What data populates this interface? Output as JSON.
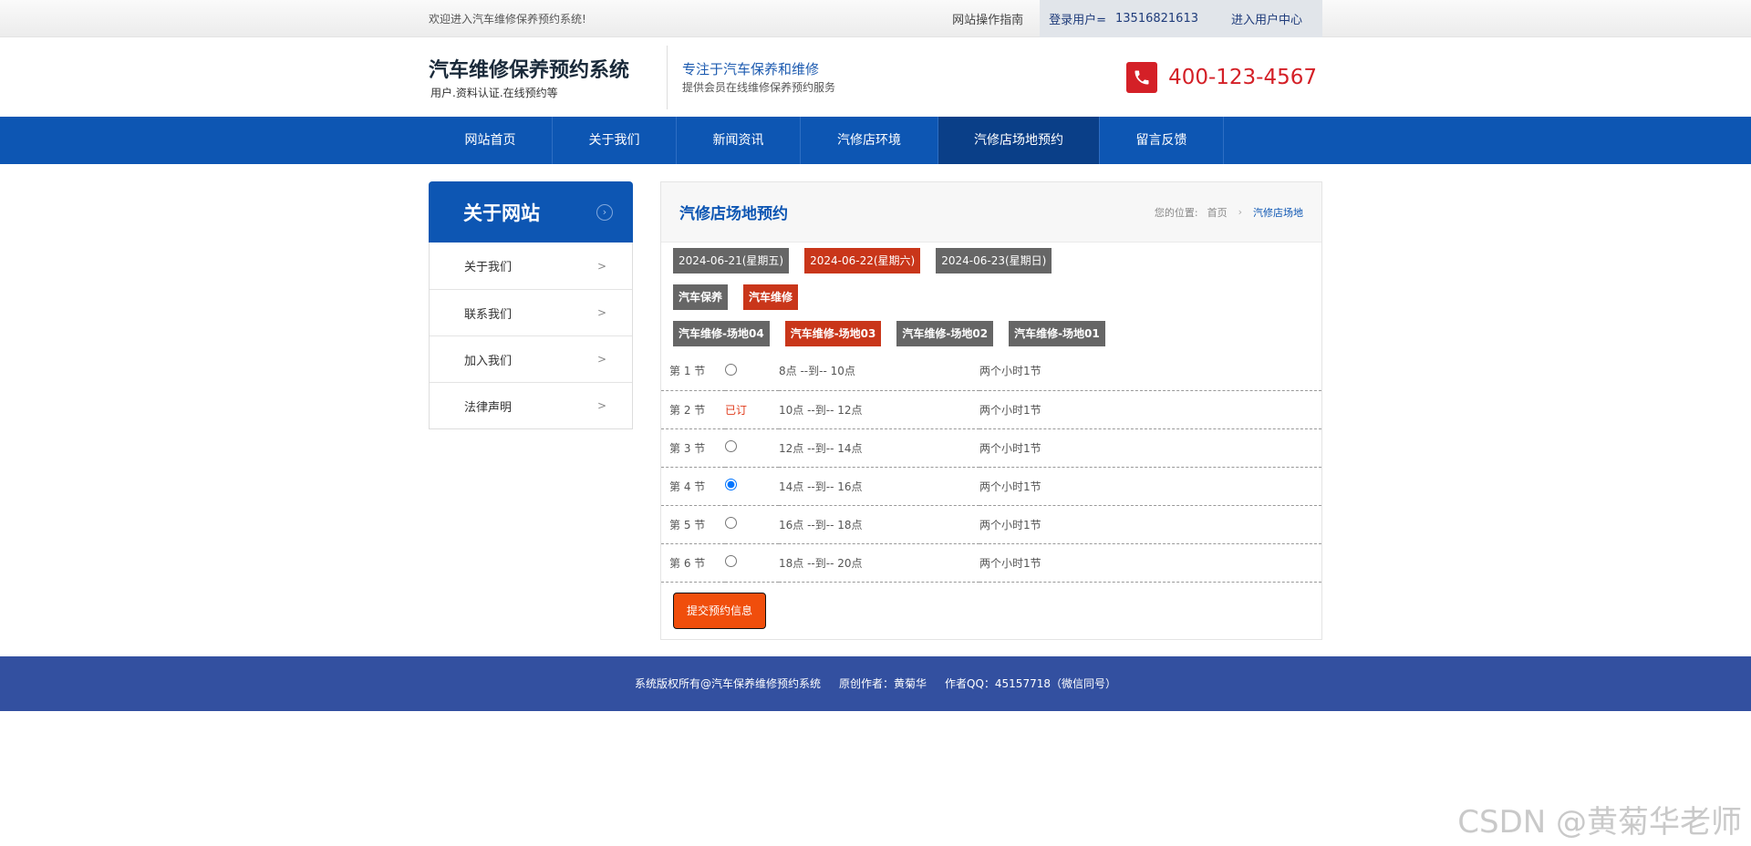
{
  "topbar": {
    "welcome": "欢迎进入汽车维修保养预约系统!",
    "guide": "网站操作指南",
    "user_label": "登录用户=",
    "user_id": "13516821613",
    "user_center": "进入用户中心"
  },
  "header": {
    "title": "汽车维修保养预约系统",
    "subtitle": "用户.资料认证.在线预约等",
    "slogan_title": "专注于汽车保养和维修",
    "slogan_sub": "提供会员在线维修保养预约服务",
    "phone": "400-123-4567"
  },
  "nav": [
    "网站首页",
    "关于我们",
    "新闻资讯",
    "汽修店环境",
    "汽修店场地预约",
    "留言反馈"
  ],
  "sidebar": {
    "title": "关于网站",
    "items": [
      "关于我们",
      "联系我们",
      "加入我们",
      "法律声明"
    ]
  },
  "content": {
    "title": "汽修店场地预约",
    "crumb_label": "您的位置:",
    "crumb_home": "首页",
    "crumb_current": "汽修店场地",
    "dates": [
      "2024-06-21(星期五)",
      "2024-06-22(星期六)",
      "2024-06-23(星期日)"
    ],
    "services": [
      "汽车保养",
      "汽车维修"
    ],
    "venues": [
      "汽车维修-场地04",
      "汽车维修-场地03",
      "汽车维修-场地02",
      "汽车维修-场地01"
    ],
    "slots": [
      {
        "label": "第 1 节",
        "booked": "",
        "time": "8点 --到-- 10点",
        "duration": "两个小时1节"
      },
      {
        "label": "第 2 节",
        "booked": "已订",
        "time": "10点 --到-- 12点",
        "duration": "两个小时1节"
      },
      {
        "label": "第 3 节",
        "booked": "",
        "time": "12点 --到-- 14点",
        "duration": "两个小时1节"
      },
      {
        "label": "第 4 节",
        "booked": "",
        "time": "14点 --到-- 16点",
        "duration": "两个小时1节"
      },
      {
        "label": "第 5 节",
        "booked": "",
        "time": "16点 --到-- 18点",
        "duration": "两个小时1节"
      },
      {
        "label": "第 6 节",
        "booked": "",
        "time": "18点 --到-- 20点",
        "duration": "两个小时1节"
      }
    ],
    "submit": "提交预约信息"
  },
  "footer": {
    "copyright": "系统版权所有@汽车保养维修预约系统",
    "author": "原创作者：黄菊华",
    "qq": "作者QQ：45157718（微信同号）"
  },
  "watermark": "CSDN @黄菊华老师",
  "colors": {
    "brand_blue": "#0d56b3",
    "active_red": "#c9361a",
    "submit_orange": "#f04e0c",
    "footer_blue": "#3350a0"
  }
}
